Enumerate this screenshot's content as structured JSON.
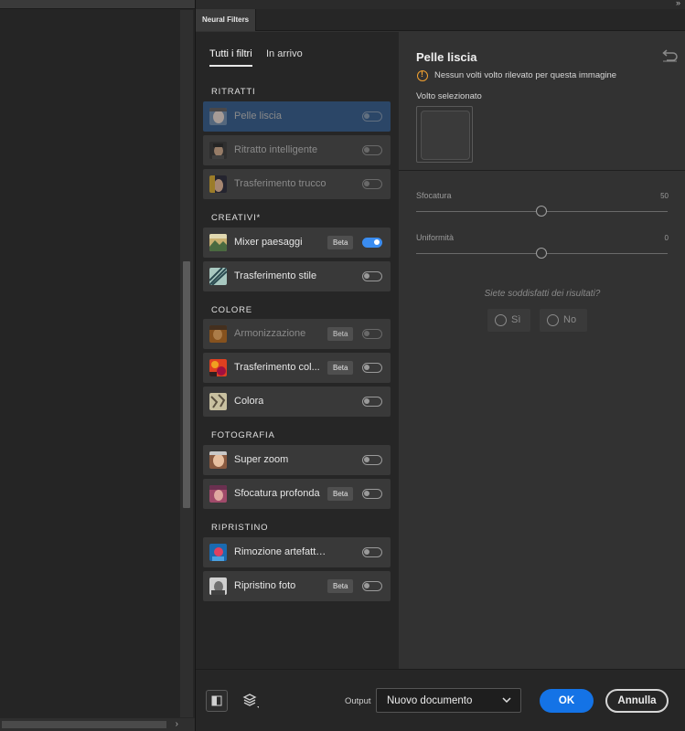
{
  "panel": {
    "tab_title": "Neural Filters"
  },
  "list": {
    "tabs": [
      {
        "label": "Tutti i filtri",
        "active": true
      },
      {
        "label": "In arrivo",
        "active": false
      }
    ],
    "sections": [
      {
        "title": "RITRATTI",
        "filters": [
          {
            "label": "Pelle liscia",
            "badge": "",
            "enabled": false,
            "selected": true,
            "dimmed": true,
            "icon": "portrait-face-thumbnail"
          },
          {
            "label": "Ritratto intelligente",
            "badge": "",
            "enabled": false,
            "selected": false,
            "dimmed": true,
            "icon": "portrait-man-thumbnail"
          },
          {
            "label": "Trasferimento trucco",
            "badge": "",
            "enabled": false,
            "selected": false,
            "dimmed": true,
            "icon": "makeup-face-thumbnail"
          }
        ]
      },
      {
        "title": "CREATIVI*",
        "filters": [
          {
            "label": "Mixer paesaggi",
            "badge": "Beta",
            "enabled": true,
            "selected": false,
            "dimmed": false,
            "icon": "landscape-thumbnail"
          },
          {
            "label": "Trasferimento stile",
            "badge": "",
            "enabled": false,
            "selected": false,
            "dimmed": false,
            "icon": "style-art-thumbnail"
          }
        ]
      },
      {
        "title": "COLORE",
        "filters": [
          {
            "label": "Armonizzazione",
            "badge": "Beta",
            "enabled": false,
            "selected": false,
            "dimmed": true,
            "icon": "harmonize-thumbnail"
          },
          {
            "label": "Trasferimento col...",
            "badge": "Beta",
            "enabled": false,
            "selected": false,
            "dimmed": false,
            "icon": "color-transfer-thumbnail"
          },
          {
            "label": "Colora",
            "badge": "",
            "enabled": false,
            "selected": false,
            "dimmed": false,
            "icon": "colorize-thumbnail"
          }
        ]
      },
      {
        "title": "FOTOGRAFIA",
        "filters": [
          {
            "label": "Super zoom",
            "badge": "",
            "enabled": false,
            "selected": false,
            "dimmed": false,
            "icon": "super-zoom-thumbnail"
          },
          {
            "label": "Sfocatura profonda",
            "badge": "Beta",
            "enabled": false,
            "selected": false,
            "dimmed": false,
            "icon": "depth-blur-thumbnail"
          }
        ]
      },
      {
        "title": "RIPRISTINO",
        "filters": [
          {
            "label": "Rimozione artefatti JPEG",
            "badge": "",
            "enabled": false,
            "selected": false,
            "dimmed": false,
            "icon": "jpeg-artifacts-thumbnail"
          },
          {
            "label": "Ripristino foto",
            "badge": "Beta",
            "enabled": false,
            "selected": false,
            "dimmed": false,
            "icon": "photo-restoration-thumbnail"
          }
        ]
      }
    ]
  },
  "settings": {
    "title": "Pelle liscia",
    "warning": "Nessun volti volto rilevato per questa immagine",
    "face_label": "Volto selezionato",
    "sliders": [
      {
        "label": "Sfocatura",
        "value": "50"
      },
      {
        "label": "Uniformità",
        "value": "0"
      }
    ],
    "feedback_question": "Siete soddisfatti dei risultati?",
    "feedback_yes": "Sì",
    "feedback_no": "No"
  },
  "footer": {
    "output_label": "Output",
    "output_value": "Nuovo documento",
    "ok_label": "OK",
    "cancel_label": "Annulla"
  },
  "colors": {
    "accent": "#1473e6",
    "toggle_on": "#3a8cf0",
    "selected_row": "#2b4667",
    "warning": "#f0a030"
  }
}
